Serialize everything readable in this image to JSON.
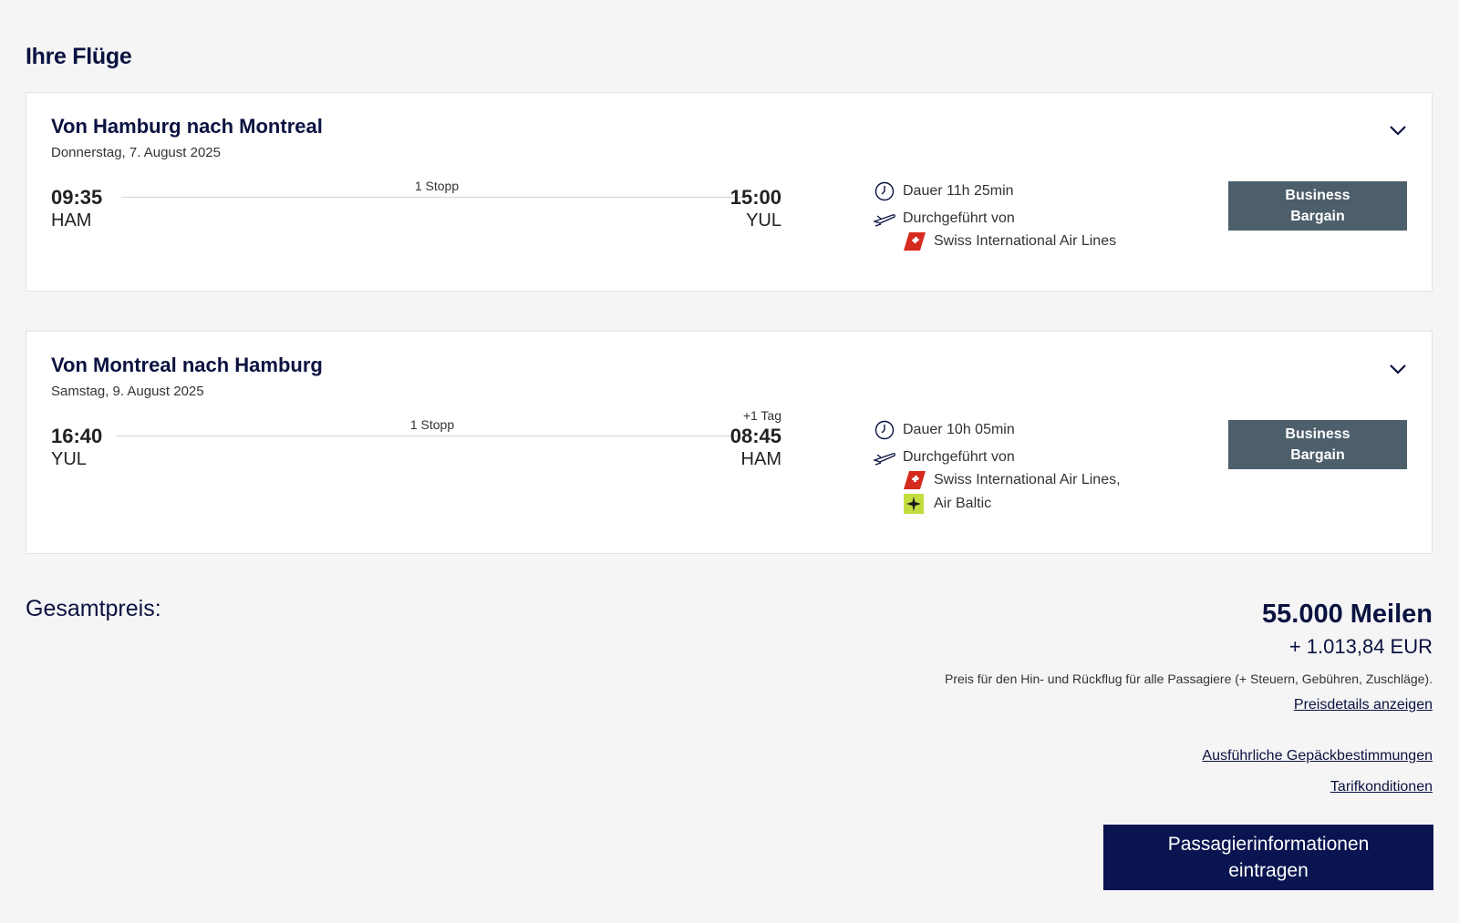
{
  "page_title": "Ihre Flüge",
  "flights": [
    {
      "route": "Von Hamburg nach Montreal",
      "date": "Donnerstag, 7. August 2025",
      "departure_time": "09:35",
      "departure_code": "HAM",
      "arrival_time": "15:00",
      "arrival_code": "YUL",
      "arrival_day_offset": "",
      "stops": "1 Stopp",
      "duration": "Dauer 11h 25min",
      "operated_by": "Durchgeführt von",
      "airlines": [
        "Swiss International Air Lines"
      ],
      "fare": "Business Bargain"
    },
    {
      "route": "Von Montreal nach Hamburg",
      "date": "Samstag, 9. August 2025",
      "departure_time": "16:40",
      "departure_code": "YUL",
      "arrival_time": "08:45",
      "arrival_code": "HAM",
      "arrival_day_offset": "+1 Tag",
      "stops": "1 Stopp",
      "duration": "Dauer 10h 05min",
      "operated_by": "Durchgeführt von",
      "airlines": [
        "Swiss International Air Lines,",
        "Air Baltic"
      ],
      "fare": "Business Bargain"
    }
  ],
  "icons": {
    "chevron": "chevron-down-icon",
    "clock": "clock-icon",
    "plane": "airplane-icon",
    "swiss_logo": "swiss-logo-icon",
    "airbaltic_logo": "airbaltic-logo-icon"
  },
  "colors": {
    "primary": "#0a1450",
    "fare_badge": "#4d5f6b",
    "swiss_red": "#d52b1e",
    "airbaltic_green": "#c5dc3f"
  },
  "summary": {
    "total_label": "Gesamtpreis:",
    "miles": "55.000 Meilen",
    "eur": "+ 1.013,84 EUR",
    "note": "Preis für den Hin- und Rückflug für alle Passagiere (+ Steuern, Gebühren, Zuschläge).",
    "price_details_link": "Preisdetails anzeigen",
    "baggage_link": "Ausführliche Gepäckbestimmungen",
    "tariff_link": "Tarifkonditionen",
    "cta": "Passagierinformationen eintragen"
  }
}
